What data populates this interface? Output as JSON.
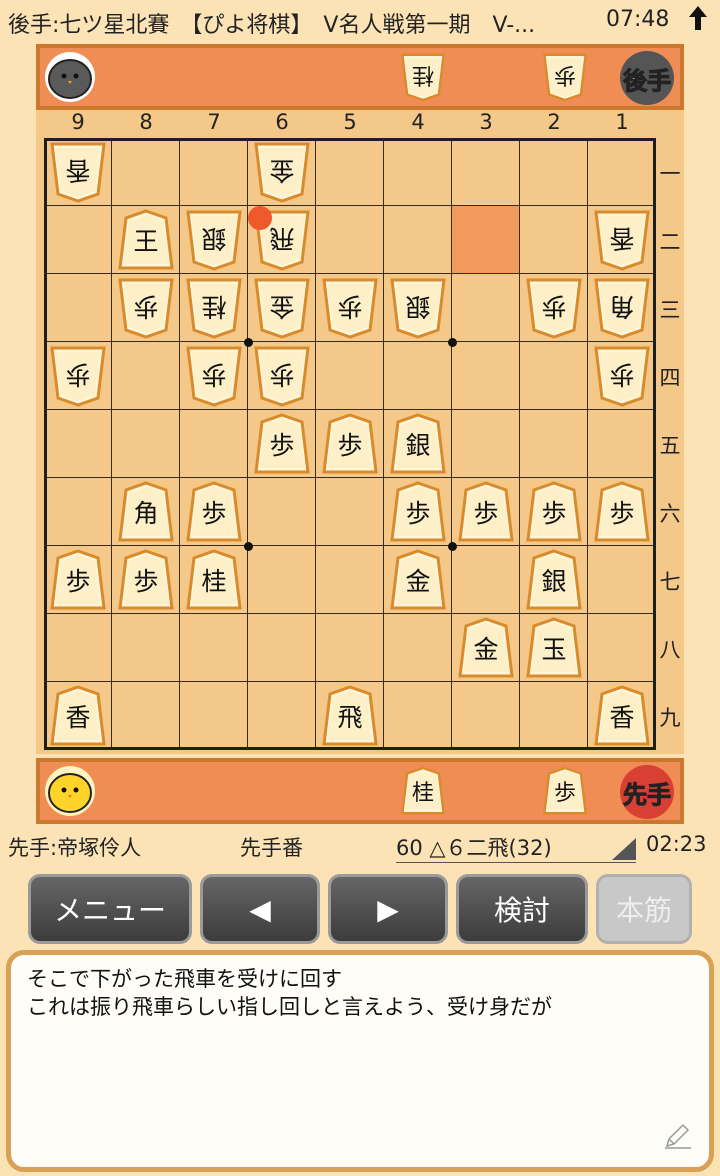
{
  "status_bar": {
    "game_info": "後手:七ツ星北賽　【ぴよ将棋】　V名人戦第一期　V-...",
    "time": "07:48",
    "signal_icon": "arrow-up-icon"
  },
  "gote": {
    "badge": "後手",
    "hand": [
      "桂",
      "歩"
    ]
  },
  "sente": {
    "badge": "先手",
    "hand": [
      "桂",
      "歩"
    ]
  },
  "board": {
    "files": [
      "9",
      "8",
      "7",
      "6",
      "5",
      "4",
      "3",
      "2",
      "1"
    ],
    "ranks": [
      "一",
      "二",
      "三",
      "四",
      "五",
      "六",
      "七",
      "八",
      "九"
    ],
    "pieces": [
      {
        "f": 9,
        "r": 1,
        "p": "香",
        "o": "gote"
      },
      {
        "f": 6,
        "r": 1,
        "p": "金",
        "o": "gote"
      },
      {
        "f": 8,
        "r": 2,
        "p": "王",
        "o": "sente"
      },
      {
        "f": 7,
        "r": 2,
        "p": "銀",
        "o": "gote"
      },
      {
        "f": 6,
        "r": 2,
        "p": "飛",
        "o": "gote"
      },
      {
        "f": 1,
        "r": 2,
        "p": "香",
        "o": "gote"
      },
      {
        "f": 8,
        "r": 3,
        "p": "歩",
        "o": "gote"
      },
      {
        "f": 7,
        "r": 3,
        "p": "桂",
        "o": "gote"
      },
      {
        "f": 6,
        "r": 3,
        "p": "金",
        "o": "gote"
      },
      {
        "f": 5,
        "r": 3,
        "p": "歩",
        "o": "gote"
      },
      {
        "f": 4,
        "r": 3,
        "p": "銀",
        "o": "gote"
      },
      {
        "f": 2,
        "r": 3,
        "p": "歩",
        "o": "gote"
      },
      {
        "f": 1,
        "r": 3,
        "p": "角",
        "o": "gote"
      },
      {
        "f": 9,
        "r": 4,
        "p": "歩",
        "o": "gote"
      },
      {
        "f": 7,
        "r": 4,
        "p": "歩",
        "o": "gote"
      },
      {
        "f": 6,
        "r": 4,
        "p": "歩",
        "o": "gote"
      },
      {
        "f": 1,
        "r": 4,
        "p": "歩",
        "o": "gote"
      },
      {
        "f": 6,
        "r": 5,
        "p": "歩",
        "o": "sente"
      },
      {
        "f": 5,
        "r": 5,
        "p": "歩",
        "o": "sente"
      },
      {
        "f": 4,
        "r": 5,
        "p": "銀",
        "o": "sente"
      },
      {
        "f": 8,
        "r": 6,
        "p": "角",
        "o": "sente"
      },
      {
        "f": 7,
        "r": 6,
        "p": "歩",
        "o": "sente"
      },
      {
        "f": 4,
        "r": 6,
        "p": "歩",
        "o": "sente"
      },
      {
        "f": 3,
        "r": 6,
        "p": "歩",
        "o": "sente"
      },
      {
        "f": 2,
        "r": 6,
        "p": "歩",
        "o": "sente"
      },
      {
        "f": 1,
        "r": 6,
        "p": "歩",
        "o": "sente"
      },
      {
        "f": 9,
        "r": 7,
        "p": "歩",
        "o": "sente"
      },
      {
        "f": 8,
        "r": 7,
        "p": "歩",
        "o": "sente"
      },
      {
        "f": 7,
        "r": 7,
        "p": "桂",
        "o": "sente"
      },
      {
        "f": 4,
        "r": 7,
        "p": "金",
        "o": "sente"
      },
      {
        "f": 2,
        "r": 7,
        "p": "銀",
        "o": "sente"
      },
      {
        "f": 3,
        "r": 8,
        "p": "金",
        "o": "sente"
      },
      {
        "f": 2,
        "r": 8,
        "p": "玉",
        "o": "sente"
      },
      {
        "f": 9,
        "r": 9,
        "p": "香",
        "o": "sente"
      },
      {
        "f": 5,
        "r": 9,
        "p": "飛",
        "o": "sente"
      },
      {
        "f": 1,
        "r": 9,
        "p": "香",
        "o": "sente"
      }
    ],
    "highlight_from": {
      "f": 3,
      "r": 2
    },
    "highlight_color": "#f29a5c",
    "last_move_marker_color": "#f0592b"
  },
  "info": {
    "player": "先手:帝塚伶人",
    "turn": "先手番",
    "move": "60 △６二飛(32)",
    "clock": "02:23"
  },
  "buttons": {
    "menu": "メニュー",
    "prev": "◀",
    "next": "▶",
    "analyze": "検討",
    "mainline": "本筋"
  },
  "comment": {
    "line1": "そこで下がった飛車を受けに回す",
    "line2": "これは振り飛車らしい指し回しと言えよう、受け身だが"
  },
  "colors": {
    "background": "#fbe3b6",
    "board": "#f3c888",
    "hand_bar": "#f08d54",
    "gote_badge": "#555555",
    "sente_badge": "#d94034"
  }
}
